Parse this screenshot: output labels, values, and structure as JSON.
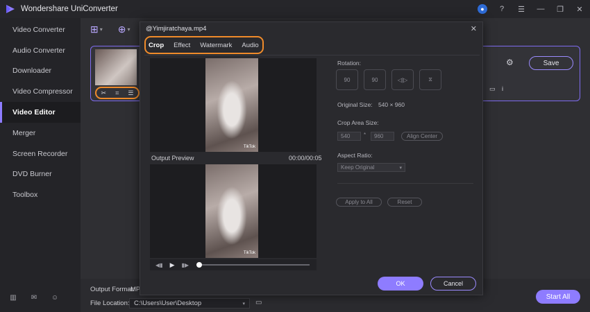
{
  "app": {
    "title": "Wondershare UniConverter",
    "brand_color": "#8e7cff",
    "highlight_color": "#f08b2a"
  },
  "sidebar": {
    "items": [
      {
        "label": "Video Converter"
      },
      {
        "label": "Audio Converter"
      },
      {
        "label": "Downloader"
      },
      {
        "label": "Video Compressor"
      },
      {
        "label": "Video Editor",
        "active": true
      },
      {
        "label": "Merger"
      },
      {
        "label": "Screen Recorder"
      },
      {
        "label": "DVD Burner"
      },
      {
        "label": "Toolbox"
      }
    ]
  },
  "main": {
    "save_label": "Save",
    "output_format_label": "Output Format:",
    "output_format_value": "MP",
    "file_location_label": "File Location:",
    "file_location_value": "C:\\Users\\User\\Desktop",
    "start_all_label": "Start All"
  },
  "dialog": {
    "title": "@Yimjiratchaya.mp4",
    "tabs": [
      {
        "label": "Crop",
        "active": true
      },
      {
        "label": "Effect"
      },
      {
        "label": "Watermark"
      },
      {
        "label": "Audio"
      }
    ],
    "output_preview_label": "Output Preview",
    "time": "00:00/00:05",
    "watermark_text": "TikTok",
    "rotation_label": "Rotation:",
    "rotate_left_text": "90",
    "rotate_right_text": "90",
    "original_size_label": "Original Size:",
    "original_size_value": "540 × 960",
    "crop_area_label": "Crop Area Size:",
    "crop_width": "540",
    "crop_height": "960",
    "crop_sep": "*",
    "align_center_label": "Align Center",
    "aspect_ratio_label": "Aspect Ratio:",
    "aspect_ratio_value": "Keep Original",
    "apply_all_label": "Apply to All",
    "reset_label": "Reset",
    "ok_label": "OK",
    "cancel_label": "Cancel"
  }
}
